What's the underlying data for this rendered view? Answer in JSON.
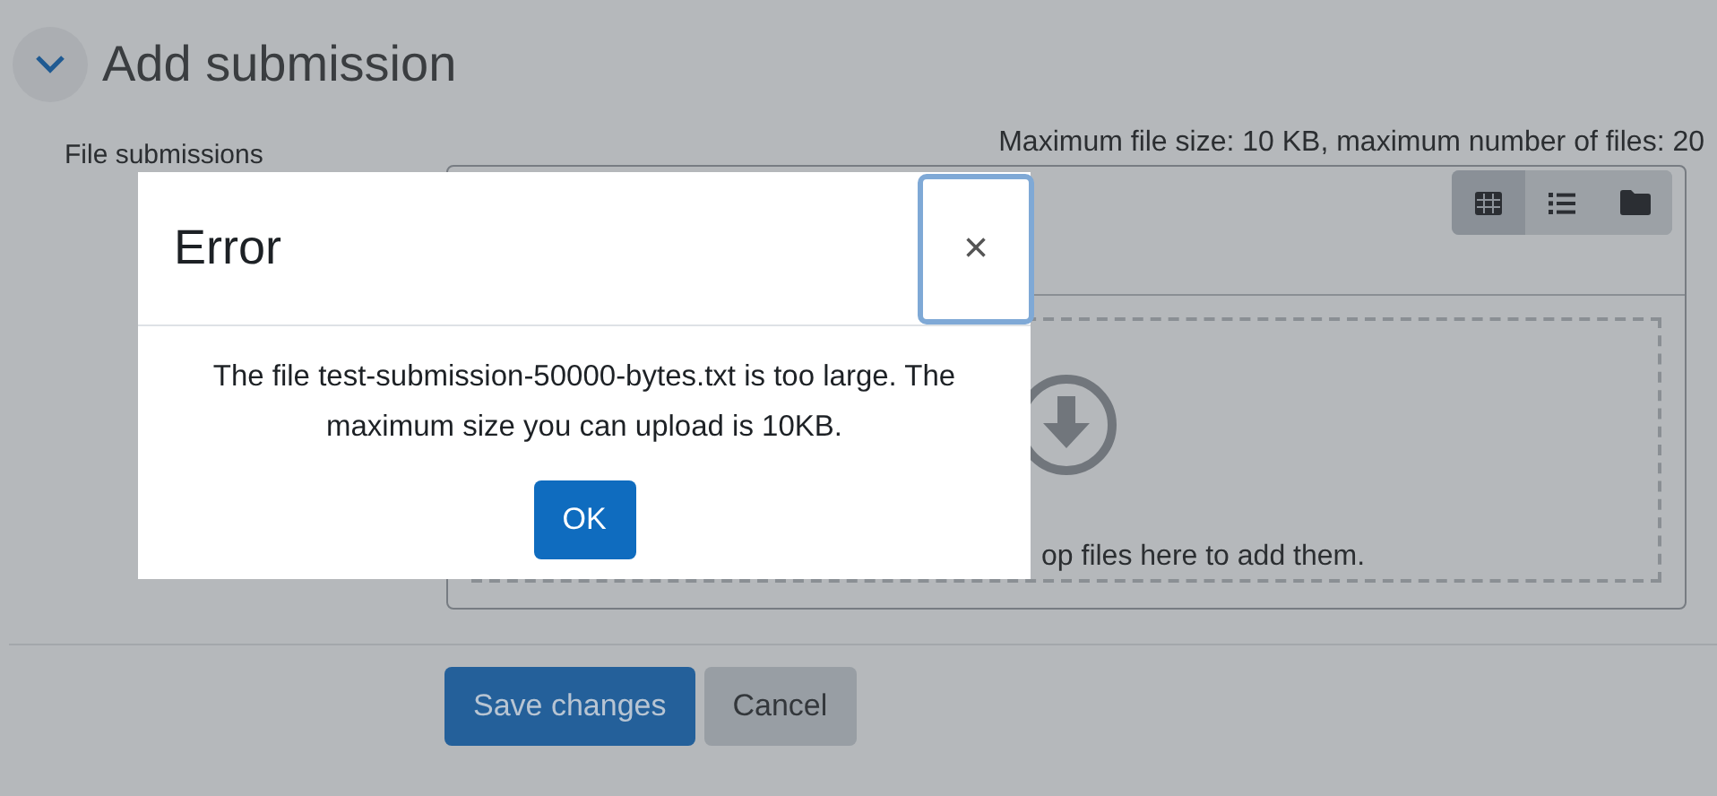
{
  "section": {
    "title": "Add submission",
    "expanded": true
  },
  "field_label": "File submissions",
  "limits": "Maximum file size: 10 KB, maximum number of files: 20",
  "view_buttons": [
    {
      "kind": "grid",
      "selected": true
    },
    {
      "kind": "list",
      "selected": false
    },
    {
      "kind": "folder",
      "selected": false
    }
  ],
  "dropzone": {
    "text": "op files here to add them."
  },
  "buttons": [
    {
      "label": "Save changes",
      "kind": "primary"
    },
    {
      "label": "Cancel",
      "kind": "secondary"
    }
  ],
  "dialog": {
    "title": "Error",
    "close": "×",
    "message": "The file test-submission-50000-bytes.txt is too large. The maximum size you can upload is 10KB.",
    "button": "OK"
  }
}
